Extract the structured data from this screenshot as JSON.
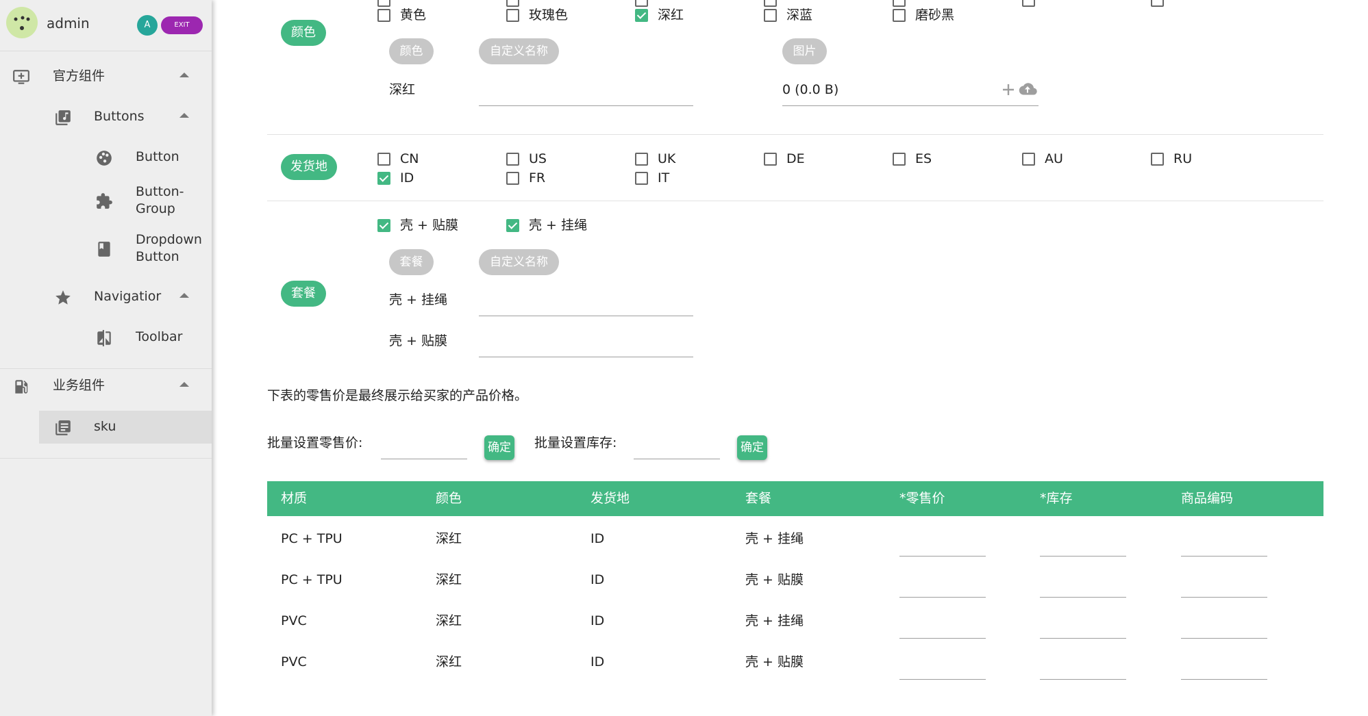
{
  "sidebar": {
    "user": {
      "name": "admin",
      "circle_btn": "A",
      "exit_label": "EXIT"
    },
    "items": [
      {
        "label": "官方组件",
        "icon": "monitor-add-icon"
      },
      {
        "label": "Buttons",
        "icon": "library-music-icon"
      },
      {
        "label": "Button",
        "icon": "palette-icon"
      },
      {
        "label": "Button-Group",
        "icon": "puzzle-icon"
      },
      {
        "label": "Dropdown Button",
        "icon": "book-icon"
      },
      {
        "label": "Navigatior",
        "icon": "star-icon"
      },
      {
        "label": "Toolbar",
        "icon": "compare-icon"
      },
      {
        "label": "业务组件",
        "icon": "gas-station-icon"
      },
      {
        "label": "sku",
        "icon": "library-books-icon"
      }
    ]
  },
  "color_section": {
    "chip": "颜色",
    "options": [
      {
        "label": "黄色",
        "checked": false
      },
      {
        "label": "玫瑰色",
        "checked": false
      },
      {
        "label": "深红",
        "checked": true
      },
      {
        "label": "深蓝",
        "checked": false
      },
      {
        "label": "磨砂黑",
        "checked": false
      }
    ],
    "col_color": "颜色",
    "col_name": "自定义名称",
    "col_image": "图片",
    "row_label": "深红",
    "file_value": "0 (0.0 B)"
  },
  "ship_section": {
    "chip": "发货地",
    "options": [
      {
        "label": "CN",
        "checked": false
      },
      {
        "label": "US",
        "checked": false
      },
      {
        "label": "UK",
        "checked": false
      },
      {
        "label": "DE",
        "checked": false
      },
      {
        "label": "ES",
        "checked": false
      },
      {
        "label": "AU",
        "checked": false
      },
      {
        "label": "RU",
        "checked": false
      },
      {
        "label": "ID",
        "checked": true
      },
      {
        "label": "FR",
        "checked": false
      },
      {
        "label": "IT",
        "checked": false
      }
    ]
  },
  "package_section": {
    "chip": "套餐",
    "options": [
      {
        "label": "壳 + 贴膜",
        "checked": true
      },
      {
        "label": "壳 + 挂绳",
        "checked": true
      }
    ],
    "col_package": "套餐",
    "col_name": "自定义名称",
    "rows": [
      "壳 + 挂绳",
      "壳 + 贴膜"
    ]
  },
  "note": "下表的零售价是最终展示给买家的产品价格。",
  "batch": {
    "price_label": "批量设置零售价:",
    "stock_label": "批量设置库存:",
    "confirm": "确定"
  },
  "table": {
    "headers": [
      "材质",
      "颜色",
      "发货地",
      "套餐",
      "*零售价",
      "*库存",
      "商品编码"
    ],
    "rows": [
      [
        "PC + TPU",
        "深红",
        "ID",
        "壳 + 挂绳"
      ],
      [
        "PC + TPU",
        "深红",
        "ID",
        "壳 + 贴膜"
      ],
      [
        "PVC",
        "深红",
        "ID",
        "壳 + 挂绳"
      ],
      [
        "PVC",
        "深红",
        "ID",
        "壳 + 贴膜"
      ]
    ]
  },
  "colors": {
    "accent": "#43b883",
    "sidebar_bg": "#eeeeee",
    "exit": "#9c27b0",
    "teal": "#26a69a",
    "chip_gray": "#c7c7c7"
  }
}
